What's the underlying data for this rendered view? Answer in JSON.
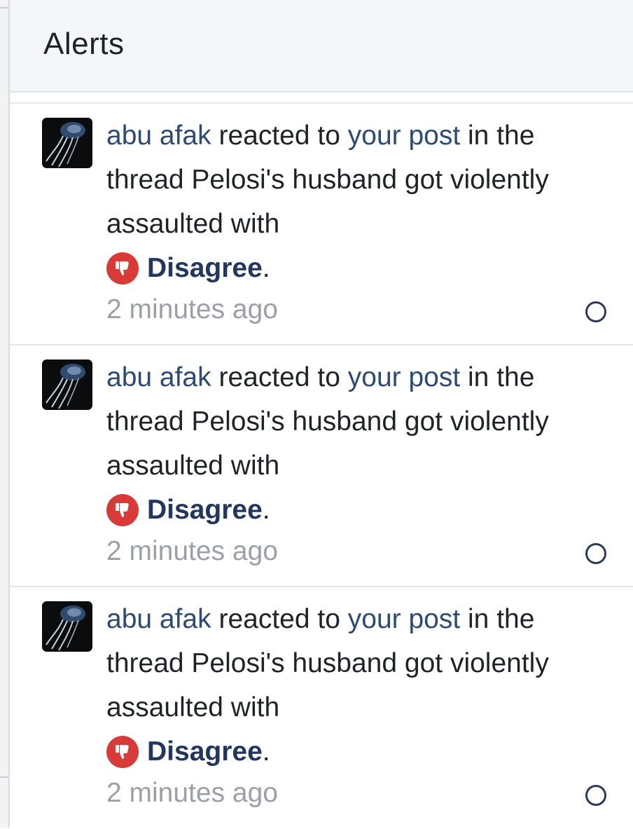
{
  "header": {
    "title": "Alerts"
  },
  "alerts": [
    {
      "user": "abu afak",
      "action_text": " reacted to ",
      "post_link": "your post",
      "middle_text": " in the thread Pelosi's husband got violently assaulted with",
      "reaction": "Disagree",
      "reaction_suffix": ".",
      "reaction_icon": "thumbs-down-icon",
      "time": "2 minutes ago"
    },
    {
      "user": "abu afak",
      "action_text": " reacted to ",
      "post_link": "your post",
      "middle_text": " in the thread Pelosi's husband got violently assaulted with",
      "reaction": "Disagree",
      "reaction_suffix": ".",
      "reaction_icon": "thumbs-down-icon",
      "time": "2 minutes ago"
    },
    {
      "user": "abu afak",
      "action_text": " reacted to ",
      "post_link": "your post",
      "middle_text": " in the thread Pelosi's husband got violently assaulted with",
      "reaction": "Disagree",
      "reaction_suffix": ".",
      "reaction_icon": "thumbs-down-icon",
      "time": "2 minutes ago"
    }
  ],
  "colors": {
    "link": "#2c4a78",
    "reaction_red": "#d93a37",
    "timestamp_gray": "#9ba0a8"
  }
}
